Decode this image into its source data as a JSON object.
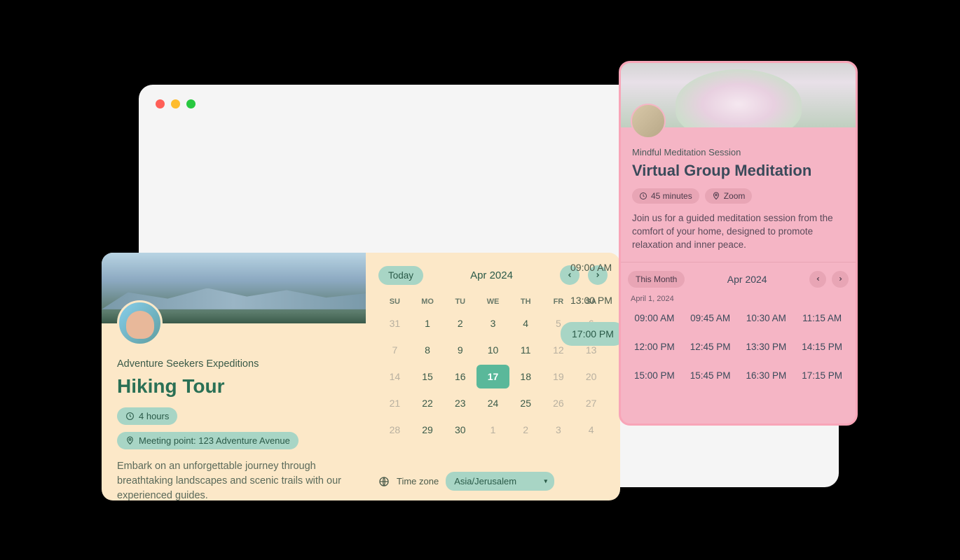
{
  "hiking": {
    "subtitle": "Adventure Seekers Expeditions",
    "title": "Hiking Tour",
    "duration": "4 hours",
    "location": "Meeting point: 123 Adventure Avenue",
    "description": "Embark on an unforgettable journey through breathtaking landscapes and scenic trails with our experienced guides.",
    "calendar": {
      "today_label": "Today",
      "month": "Apr 2024",
      "dow": [
        "SU",
        "MO",
        "TU",
        "WE",
        "TH",
        "FR",
        "SA"
      ],
      "days": [
        {
          "n": "31",
          "muted": true
        },
        {
          "n": "1"
        },
        {
          "n": "2"
        },
        {
          "n": "3"
        },
        {
          "n": "4"
        },
        {
          "n": "5",
          "muted": true
        },
        {
          "n": "6",
          "muted": true
        },
        {
          "n": "7",
          "muted": true
        },
        {
          "n": "8"
        },
        {
          "n": "9"
        },
        {
          "n": "10"
        },
        {
          "n": "11"
        },
        {
          "n": "12",
          "muted": true
        },
        {
          "n": "13",
          "muted": true
        },
        {
          "n": "14",
          "muted": true
        },
        {
          "n": "15"
        },
        {
          "n": "16"
        },
        {
          "n": "17",
          "selected": true
        },
        {
          "n": "18"
        },
        {
          "n": "19",
          "muted": true
        },
        {
          "n": "20",
          "muted": true
        },
        {
          "n": "21",
          "muted": true
        },
        {
          "n": "22"
        },
        {
          "n": "23"
        },
        {
          "n": "24"
        },
        {
          "n": "25"
        },
        {
          "n": "26",
          "muted": true
        },
        {
          "n": "27",
          "muted": true
        },
        {
          "n": "28",
          "muted": true
        },
        {
          "n": "29"
        },
        {
          "n": "30"
        },
        {
          "n": "1",
          "muted": true
        },
        {
          "n": "2",
          "muted": true
        },
        {
          "n": "3",
          "muted": true
        },
        {
          "n": "4",
          "muted": true
        }
      ]
    },
    "timezone_label": "Time zone",
    "timezone_value": "Asia/Jerusalem",
    "time_slots": [
      "09:00 AM",
      "13:00 PM",
      "17:00 PM"
    ],
    "selected_slot": "17:00 PM"
  },
  "meditation": {
    "subtitle": "Mindful Meditation Session",
    "title": "Virtual Group Meditation",
    "duration": "45 minutes",
    "location": "Zoom",
    "description": "Join us for a guided meditation session from the comfort of your home, designed to promote relaxation and inner peace.",
    "calendar": {
      "this_month_label": "This Month",
      "month": "Apr 2024",
      "date_label": "April 1, 2024",
      "times": [
        "09:00 AM",
        "09:45 AM",
        "10:30 AM",
        "11:15 AM",
        "12:00 PM",
        "12:45 PM",
        "13:30 PM",
        "14:15 PM",
        "15:00 PM",
        "15:45 PM",
        "16:30 PM",
        "17:15 PM"
      ]
    }
  },
  "colors": {
    "hiking_accent": "#a8d5c5",
    "hiking_primary": "#2a7055",
    "meditation_bg": "#f5b5c5",
    "meditation_accent": "#e8a5b5"
  }
}
